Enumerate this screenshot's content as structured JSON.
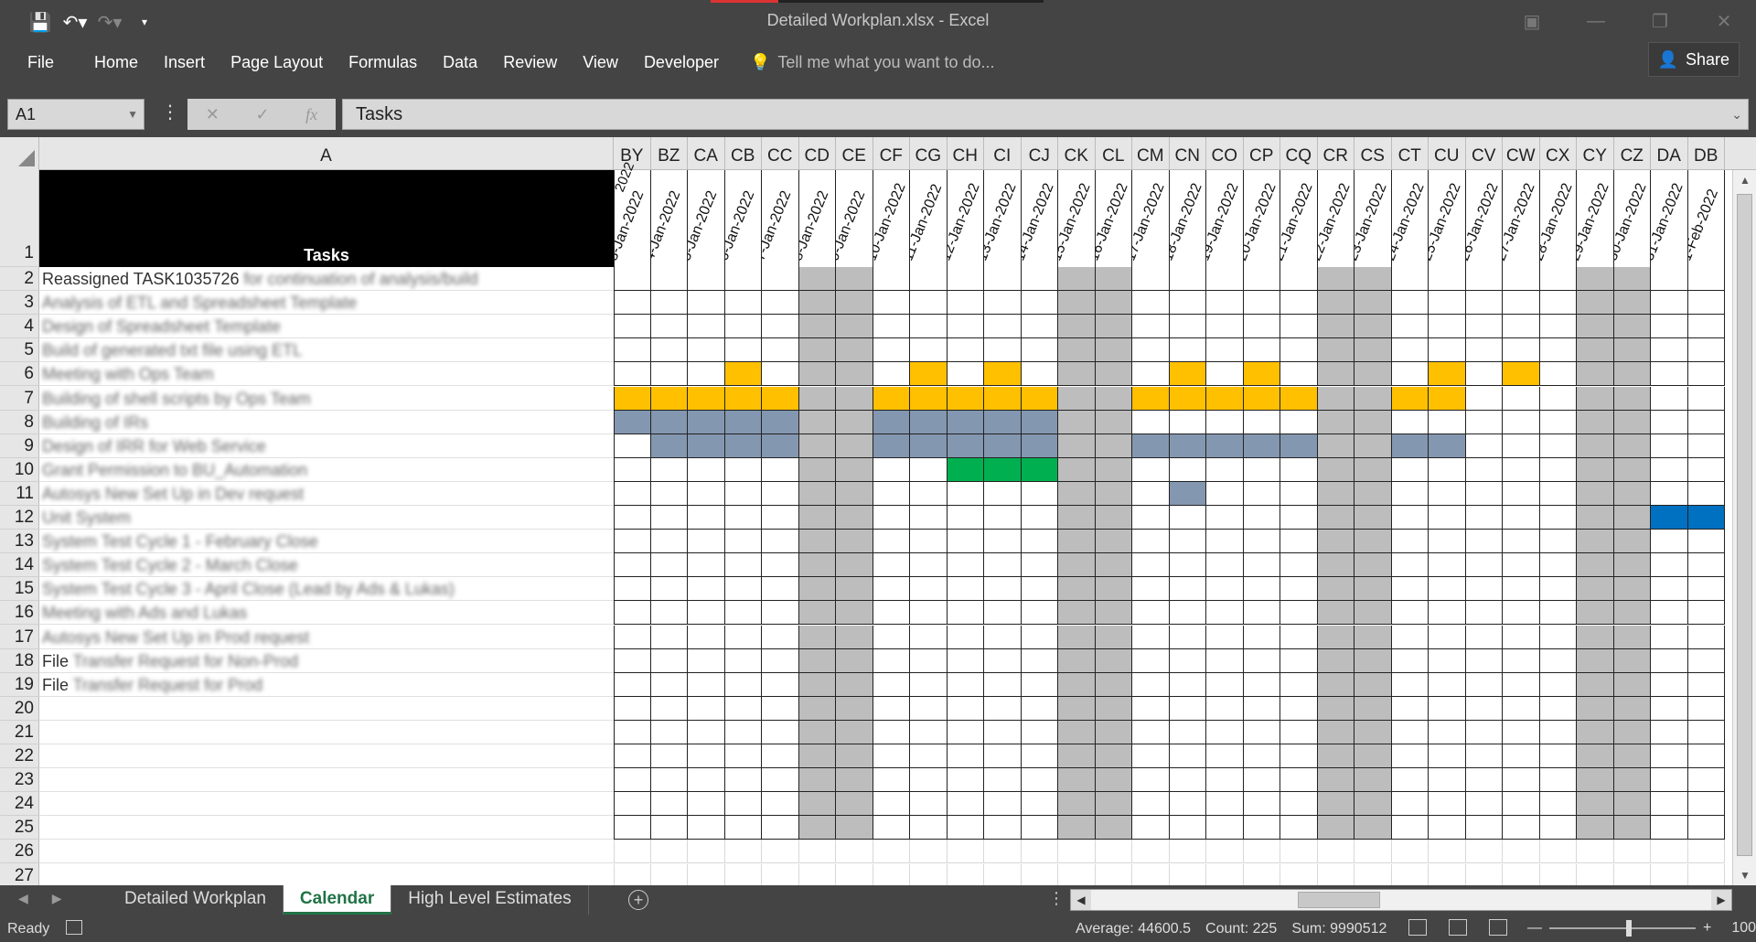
{
  "window": {
    "title": "Detailed Workplan.xlsx - Excel"
  },
  "ribbon": {
    "tabs": [
      "File",
      "Home",
      "Insert",
      "Page Layout",
      "Formulas",
      "Data",
      "Review",
      "View",
      "Developer"
    ],
    "tell_me": "Tell me what you want to do...",
    "share": "Share"
  },
  "formula_bar": {
    "name_box": "A1",
    "formula": "Tasks"
  },
  "column_a": {
    "letter": "A",
    "header": "Tasks"
  },
  "date_columns": [
    {
      "col": "BY",
      "date": "3-Jan-2022",
      "weekend": false
    },
    {
      "col": "BZ",
      "date": "4-Jan-2022",
      "weekend": false
    },
    {
      "col": "CA",
      "date": "5-Jan-2022",
      "weekend": false
    },
    {
      "col": "CB",
      "date": "6-Jan-2022",
      "weekend": false
    },
    {
      "col": "CC",
      "date": "7-Jan-2022",
      "weekend": false
    },
    {
      "col": "CD",
      "date": "8-Jan-2022",
      "weekend": true
    },
    {
      "col": "CE",
      "date": "9-Jan-2022",
      "weekend": true
    },
    {
      "col": "CF",
      "date": "10-Jan-2022",
      "weekend": false
    },
    {
      "col": "CG",
      "date": "11-Jan-2022",
      "weekend": false
    },
    {
      "col": "CH",
      "date": "12-Jan-2022",
      "weekend": false
    },
    {
      "col": "CI",
      "date": "13-Jan-2022",
      "weekend": false
    },
    {
      "col": "CJ",
      "date": "14-Jan-2022",
      "weekend": false
    },
    {
      "col": "CK",
      "date": "15-Jan-2022",
      "weekend": true
    },
    {
      "col": "CL",
      "date": "16-Jan-2022",
      "weekend": true
    },
    {
      "col": "CM",
      "date": "17-Jan-2022",
      "weekend": false
    },
    {
      "col": "CN",
      "date": "18-Jan-2022",
      "weekend": false
    },
    {
      "col": "CO",
      "date": "19-Jan-2022",
      "weekend": false
    },
    {
      "col": "CP",
      "date": "20-Jan-2022",
      "weekend": false
    },
    {
      "col": "CQ",
      "date": "21-Jan-2022",
      "weekend": false
    },
    {
      "col": "CR",
      "date": "22-Jan-2022",
      "weekend": true
    },
    {
      "col": "CS",
      "date": "23-Jan-2022",
      "weekend": true
    },
    {
      "col": "CT",
      "date": "24-Jan-2022",
      "weekend": false
    },
    {
      "col": "CU",
      "date": "25-Jan-2022",
      "weekend": false
    },
    {
      "col": "CV",
      "date": "26-Jan-2022",
      "weekend": false
    },
    {
      "col": "CW",
      "date": "27-Jan-2022",
      "weekend": false
    },
    {
      "col": "CX",
      "date": "28-Jan-2022",
      "weekend": false
    },
    {
      "col": "CY",
      "date": "29-Jan-2022",
      "weekend": true
    },
    {
      "col": "CZ",
      "date": "30-Jan-2022",
      "weekend": true
    },
    {
      "col": "DA",
      "date": "31-Jan-2022",
      "weekend": false
    },
    {
      "col": "DB",
      "date": "1-Feb-2022",
      "weekend": false
    }
  ],
  "partial_first_date": "2022",
  "rows": [
    {
      "n": "1",
      "task": "Tasks"
    },
    {
      "n": "2",
      "task": "Reassigned TASK1035726 for continuation of analysis/build",
      "clear": "Reassigned TASK1035726",
      "fills": {}
    },
    {
      "n": "3",
      "task": "Analysis of ETL and Spreadsheet Template",
      "fills": {}
    },
    {
      "n": "4",
      "task": "Design of Spreadsheet Template",
      "fills": {}
    },
    {
      "n": "5",
      "task": "Build of generated txt file using ETL",
      "fills": {}
    },
    {
      "n": "6",
      "task": "Meeting with Ops Team",
      "fills": {
        "CB": "orange",
        "CG": "orange",
        "CI": "orange",
        "CN": "orange",
        "CP": "orange",
        "CU": "orange",
        "CW": "orange"
      }
    },
    {
      "n": "7",
      "task": "Building of shell scripts by Ops Team",
      "fills": {
        "BY": "orange",
        "BZ": "orange",
        "CA": "orange",
        "CB": "orange",
        "CC": "orange",
        "CF": "orange",
        "CG": "orange",
        "CH": "orange",
        "CI": "orange",
        "CJ": "orange",
        "CM": "orange",
        "CN": "orange",
        "CO": "orange",
        "CP": "orange",
        "CQ": "orange",
        "CT": "orange",
        "CU": "orange"
      }
    },
    {
      "n": "8",
      "task": "Building of IRs",
      "fills": {
        "BY": "slate",
        "BZ": "slate",
        "CA": "slate",
        "CB": "slate",
        "CC": "slate",
        "CF": "slate",
        "CG": "slate",
        "CH": "slate",
        "CI": "slate",
        "CJ": "slate"
      }
    },
    {
      "n": "9",
      "task": "Design of IRR for Web Service",
      "fills": {
        "BZ": "slate",
        "CA": "slate",
        "CB": "slate",
        "CC": "slate",
        "CF": "slate",
        "CG": "slate",
        "CH": "slate",
        "CI": "slate",
        "CJ": "slate",
        "CM": "slate",
        "CN": "slate",
        "CO": "slate",
        "CP": "slate",
        "CQ": "slate",
        "CT": "slate",
        "CU": "slate"
      }
    },
    {
      "n": "10",
      "task": "Grant Permission to BU_Automation",
      "fills": {
        "CH": "green",
        "CI": "green",
        "CJ": "green"
      }
    },
    {
      "n": "11",
      "task": "Autosys New Set Up in Dev request",
      "fills": {
        "CN": "slate"
      }
    },
    {
      "n": "12",
      "task": "Unit System",
      "fills": {
        "DA": "blue",
        "DB": "blue"
      }
    },
    {
      "n": "13",
      "task": "System Test Cycle 1 - February Close",
      "fills": {}
    },
    {
      "n": "14",
      "task": "System Test Cycle 2 - March Close",
      "fills": {}
    },
    {
      "n": "15",
      "task": "System Test Cycle 3 - April Close (Lead by Ads & Lukas)",
      "fills": {}
    },
    {
      "n": "16",
      "task": "Meeting with Ads and Lukas",
      "fills": {}
    },
    {
      "n": "17",
      "task": "Autosys New Set Up in Prod request",
      "fills": {}
    },
    {
      "n": "18",
      "task": "File Transfer Request for Non-Prod",
      "clear": "File",
      "fills": {}
    },
    {
      "n": "19",
      "task": "File Transfer Request for Prod",
      "clear": "File",
      "fills": {}
    },
    {
      "n": "20",
      "task": ""
    },
    {
      "n": "21",
      "task": ""
    },
    {
      "n": "22",
      "task": ""
    },
    {
      "n": "23",
      "task": ""
    },
    {
      "n": "24",
      "task": ""
    },
    {
      "n": "25",
      "task": ""
    },
    {
      "n": "26",
      "task": ""
    },
    {
      "n": "27",
      "task": ""
    }
  ],
  "colors": {
    "orange": "#ffc000",
    "slate": "#8497b0",
    "green": "#00b050",
    "blue": "#0070c0",
    "weekend": "#bdbdbd"
  },
  "sheets": {
    "tabs": [
      "Detailed Workplan",
      "Calendar",
      "High Level Estimates"
    ],
    "active": "Calendar"
  },
  "status": {
    "ready": "Ready",
    "average": "Average: 44600.5",
    "count": "Count: 225",
    "sum": "Sum: 9990512",
    "zoom": "100%"
  }
}
